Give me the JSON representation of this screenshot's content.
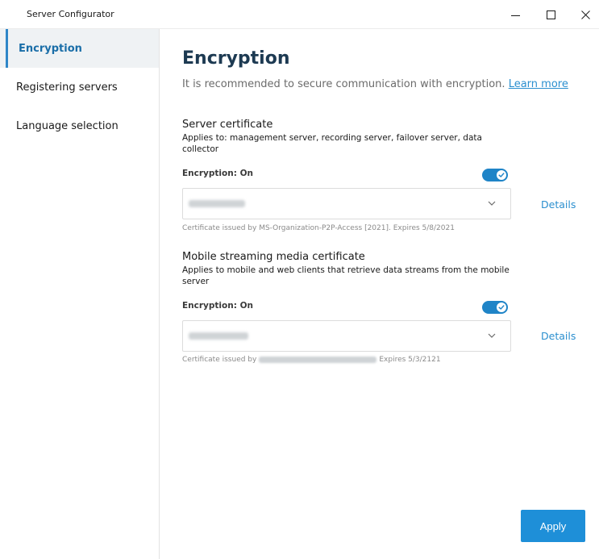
{
  "window": {
    "title": "Server Configurator"
  },
  "sidebar": {
    "items": [
      {
        "label": "Encryption",
        "active": true
      },
      {
        "label": "Registering servers",
        "active": false
      },
      {
        "label": "Language selection",
        "active": false
      }
    ]
  },
  "main": {
    "title": "Encryption",
    "subtitle": "It is recommended to secure communication with encryption.",
    "learn_more": "Learn more",
    "sections": [
      {
        "title": "Server certificate",
        "description": "Applies to: management server, recording server, failover server, data collector",
        "encryption_label": "Encryption: On",
        "toggle_on": true,
        "details_label": "Details",
        "cert_info": "Certificate issued by MS-Organization-P2P-Access [2021]. Expires 5/8/2021"
      },
      {
        "title": "Mobile streaming media certificate",
        "description": "Applies to mobile and web clients that retrieve data streams from the mobile server",
        "encryption_label": "Encryption: On",
        "toggle_on": true,
        "details_label": "Details",
        "cert_info_prefix": "Certificate issued by",
        "cert_info_suffix": "Expires 5/3/2121"
      }
    ],
    "apply_label": "Apply"
  },
  "colors": {
    "accent": "#1e8fd8",
    "link": "#2b8fcf",
    "title": "#1d3a52"
  }
}
